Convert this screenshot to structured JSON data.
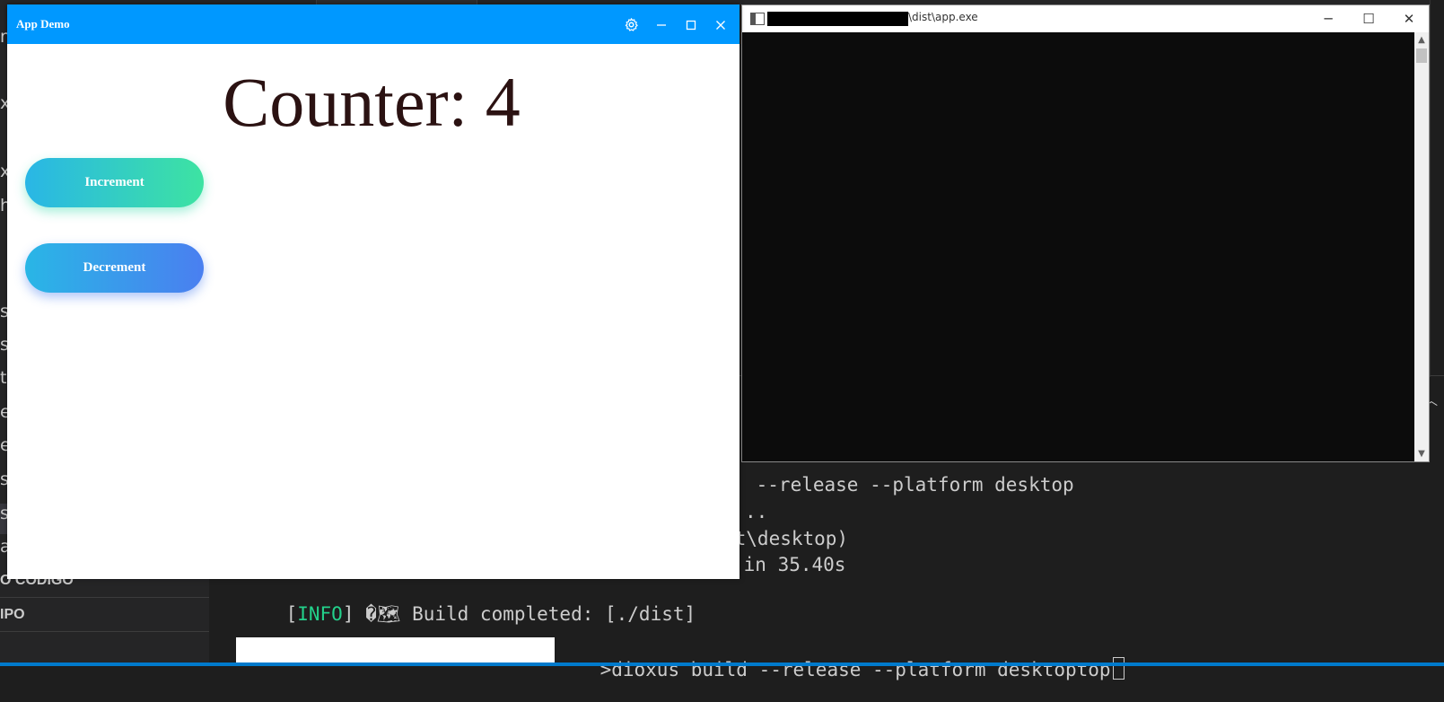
{
  "background_editor": {
    "sidebar_fragments": [
      "n",
      "x",
      "x",
      "h",
      "s",
      "s",
      "t",
      "e",
      "e",
      "s",
      "s",
      "a"
    ],
    "section_headers": [
      "O CÓDIGO",
      "IPO"
    ],
    "colors": {
      "editor_bg": "#1e1e1e",
      "sidebar_bg": "#252526",
      "status_bar": "#007acc"
    }
  },
  "terminal": {
    "lines": [
      " --release --platform desktop",
      "..",
      "st\\desktop)",
      " in 35.40s"
    ],
    "info_line": {
      "open_bracket": "[",
      "tag": "INFO",
      "close_bracket": "]",
      "glyph": " �🗺 ",
      "text": "Build completed: [./dist]"
    },
    "prompt_line": {
      "prompt_suffix": ">",
      "command": "dioxus build --release --platform desktoptop"
    },
    "colors": {
      "text": "#cccccc",
      "info_tag": "#23d18b"
    }
  },
  "console_window": {
    "title_suffix": "\\dist\\app.exe",
    "controls": {
      "minimize": "─",
      "maximize": "☐",
      "close": "✕"
    },
    "scroll": {
      "up": "▲",
      "down": "▼"
    },
    "colors": {
      "body": "#0c0c0c",
      "titlebar": "#ffffff"
    }
  },
  "app_window": {
    "title": "App Demo",
    "icons": {
      "settings": "gear-icon",
      "minimize": "minimize-icon",
      "maximize": "maximize-icon",
      "close": "close-icon"
    },
    "counter_text": "Counter: 4",
    "buttons": {
      "increment_label": "Increment",
      "decrement_label": "Decrement"
    },
    "colors": {
      "titlebar": "#0098ff",
      "counter_text": "#2b1212"
    }
  }
}
